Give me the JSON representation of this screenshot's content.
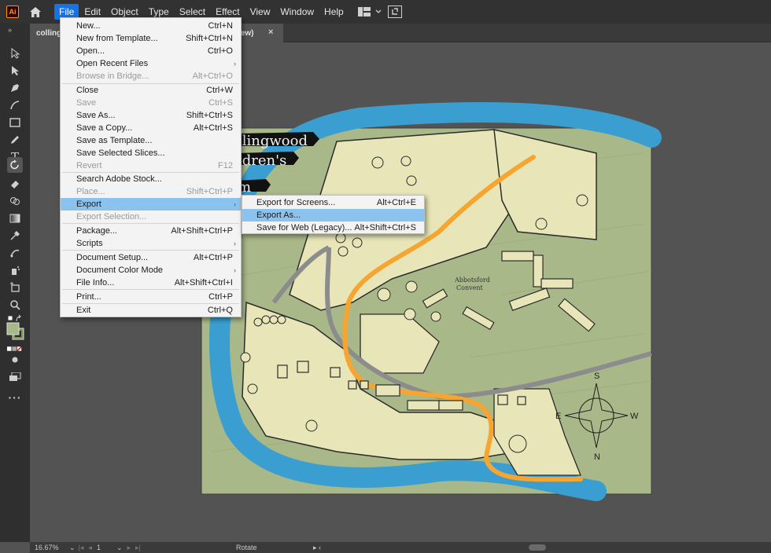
{
  "app": {
    "logo_text": "Ai",
    "menus": [
      "File",
      "Edit",
      "Object",
      "Type",
      "Select",
      "Effect",
      "View",
      "Window",
      "Help"
    ],
    "active_menu": "File"
  },
  "tab": {
    "title_left": "colling",
    "title_right": "iew)",
    "close": "×"
  },
  "file_menu": {
    "items": [
      {
        "label": "New...",
        "shortcut": "Ctrl+N"
      },
      {
        "label": "New from Template...",
        "shortcut": "Shift+Ctrl+N"
      },
      {
        "label": "Open...",
        "shortcut": "Ctrl+O"
      },
      {
        "label": "Open Recent Files",
        "shortcut": ""
      },
      {
        "label": "Browse in Bridge...",
        "shortcut": "Alt+Ctrl+O"
      },
      {
        "label": "Close",
        "shortcut": "Ctrl+W"
      },
      {
        "label": "Save",
        "shortcut": "Ctrl+S"
      },
      {
        "label": "Save As...",
        "shortcut": "Shift+Ctrl+S"
      },
      {
        "label": "Save a Copy...",
        "shortcut": "Alt+Ctrl+S"
      },
      {
        "label": "Save as Template...",
        "shortcut": ""
      },
      {
        "label": "Save Selected Slices...",
        "shortcut": ""
      },
      {
        "label": "Revert",
        "shortcut": "F12"
      },
      {
        "label": "Search Adobe Stock...",
        "shortcut": ""
      },
      {
        "label": "Place...",
        "shortcut": "Shift+Ctrl+P"
      },
      {
        "label": "Export",
        "shortcut": ""
      },
      {
        "label": "Export Selection...",
        "shortcut": ""
      },
      {
        "label": "Package...",
        "shortcut": "Alt+Shift+Ctrl+P"
      },
      {
        "label": "Scripts",
        "shortcut": ""
      },
      {
        "label": "Document Setup...",
        "shortcut": "Alt+Ctrl+P"
      },
      {
        "label": "Document Color Mode",
        "shortcut": ""
      },
      {
        "label": "File Info...",
        "shortcut": "Alt+Shift+Ctrl+I"
      },
      {
        "label": "Print...",
        "shortcut": "Ctrl+P"
      },
      {
        "label": "Exit",
        "shortcut": "Ctrl+Q"
      }
    ],
    "submenu_arrow": "›"
  },
  "export_submenu": {
    "items": [
      {
        "label": "Export for Screens...",
        "shortcut": "Alt+Ctrl+E"
      },
      {
        "label": "Export As...",
        "shortcut": ""
      },
      {
        "label": "Save for Web (Legacy)...",
        "shortcut": "Alt+Shift+Ctrl+S"
      }
    ]
  },
  "artwork": {
    "title_lines": [
      "llingwood",
      "ldren's",
      "m"
    ],
    "labels": [
      "Abbotsford",
      "Convent"
    ],
    "compass": {
      "n": "N",
      "s": "S",
      "e": "E",
      "w": "W"
    }
  },
  "status": {
    "zoom": "16.67%",
    "artboard": "1",
    "rotate": "Rotate"
  },
  "colors": {
    "accent": "#1473e6",
    "menu_highlight": "#8cc3ee",
    "menu_bg": "#f3f3f3",
    "river": "#3a9fd0",
    "path": "#f6a531",
    "land": "#e8e6b8",
    "grass": "#a9b889"
  }
}
